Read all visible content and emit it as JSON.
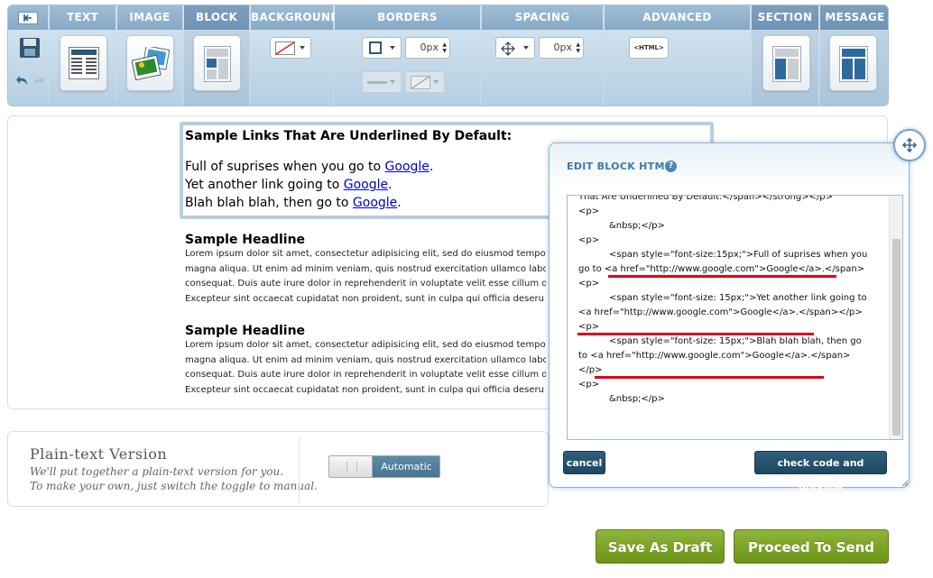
{
  "toolbar": {
    "sections": {
      "text": "TEXT",
      "image": "IMAGE",
      "block": "BLOCK",
      "background": "BACKGROUND",
      "borders": "BORDERS",
      "spacing": "SPACING",
      "advanced": "ADVANCED",
      "section": "SECTION",
      "message": "MESSAGE"
    },
    "border_width": "0px",
    "spacing_value": "0px",
    "html_label": "<HTML>"
  },
  "editor": {
    "links_title": "Sample Links That Are Underlined By Default:",
    "link_lines": [
      {
        "text": "Full of suprises when you go to ",
        "link": "Google",
        "tail": "."
      },
      {
        "text": "Yet another link going to ",
        "link": "Google",
        "tail": "."
      },
      {
        "text": "Blah blah blah, then go to ",
        "link": "Google",
        "tail": "."
      }
    ],
    "headline_1": "Sample Headline",
    "headline_2": "Sample Headline",
    "lorem_lines": [
      "Lorem ipsum dolor sit amet, consectetur adipisicing elit, sed do eiusmod tempor",
      "magna aliqua. Ut enim ad minim veniam, quis nostrud exercitation ullamco laboris",
      "consequat. Duis aute irure dolor in reprehenderit in voluptate velit esse cillum de",
      "Excepteur sint occaecat cupidatat non proident, sunt in culpa qui officia deseru"
    ]
  },
  "plain_text": {
    "title": "Plain-text Version",
    "desc_1": "We'll put together a plain-text version for you.",
    "desc_2": "To make your own, just switch the toggle to manual.",
    "toggle_label": "Automatic"
  },
  "dialog": {
    "title": "EDIT BLOCK HTML",
    "help": "?",
    "code_lines": [
      {
        "t": "That Are Underlined By Default:</span></strong></p>",
        "indent": false
      },
      {
        "t": "<p>",
        "indent": false
      },
      {
        "t": "&nbsp;</p>",
        "indent": true
      },
      {
        "t": "<p>",
        "indent": false
      },
      {
        "t": "<span style=\"font-size:15px;\">Full of suprises when you",
        "indent": true
      },
      {
        "t": "go to <a href=\"http://www.google.com\">Google</a>.</span>",
        "indent": false
      },
      {
        "t": "<p>",
        "indent": false
      },
      {
        "t": "<span style=\"font-size: 15px;\">Yet another link going to",
        "indent": true
      },
      {
        "t": "<a href=\"http://www.google.com\">Google</a>.</span></p>",
        "indent": false
      },
      {
        "t": "<p>",
        "indent": false
      },
      {
        "t": "<span style=\"font-size: 15px;\">Blah blah blah, then go",
        "indent": true
      },
      {
        "t": "to <a href=\"http://www.google.com\">Google</a>.</span>",
        "indent": false
      },
      {
        "t": "</p>",
        "indent": false
      },
      {
        "t": "<p>",
        "indent": false
      },
      {
        "t": "&nbsp;</p>",
        "indent": true
      }
    ],
    "cancel": "cancel",
    "check": "check code and preview"
  },
  "actions": {
    "save_draft": "Save As Draft",
    "proceed": "Proceed To Send"
  },
  "colors": {
    "accent_blue": "#3e7ba4",
    "dialog_button": "#1d4861",
    "green_button": "#7aa222",
    "link": "#0000cc",
    "error_underline": "#e0001a"
  }
}
